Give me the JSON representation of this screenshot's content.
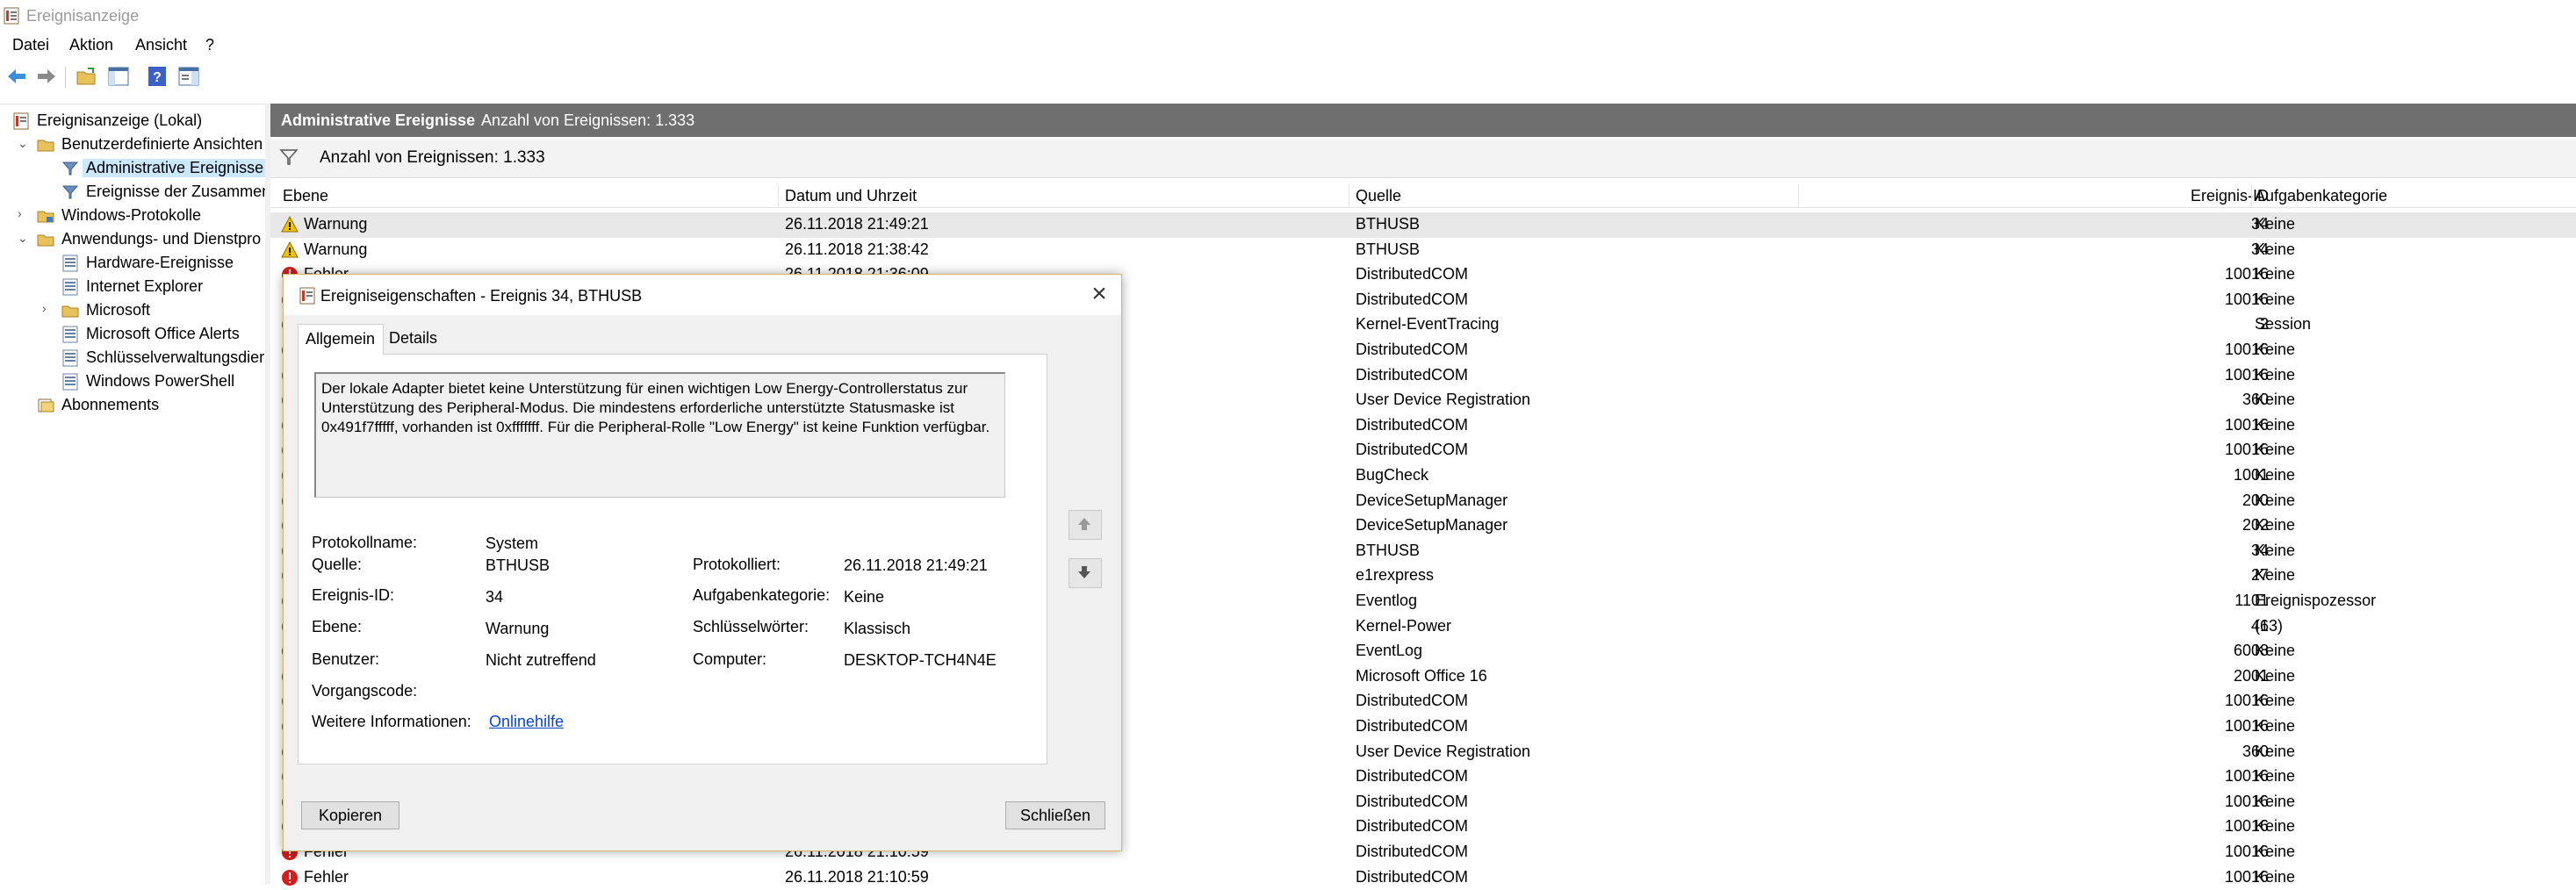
{
  "window": {
    "title": "Ereignisanzeige"
  },
  "menu": [
    "Datei",
    "Aktion",
    "Ansicht",
    "?"
  ],
  "toolbar": {
    "icons": [
      "back-arrow-icon",
      "forward-arrow-icon",
      "open-folder-icon",
      "show-pane-icon",
      "help-icon",
      "properties-pane-icon"
    ]
  },
  "tree": {
    "root": "Ereignisanzeige (Lokal)",
    "custom_views": "Benutzerdefinierte Ansichten",
    "admin_events": "Administrative Ereignisse",
    "summary_events": "Ereignisse der Zusammen",
    "windows_logs": "Windows-Protokolle",
    "apps_services": "Anwendungs- und Dienstpro",
    "hardware": "Hardware-Ereignisse",
    "ie": "Internet Explorer",
    "microsoft": "Microsoft",
    "office_alerts": "Microsoft Office Alerts",
    "key_mgmt": "Schlüsselverwaltungsdier",
    "powershell": "Windows PowerShell",
    "subscriptions": "Abonnements"
  },
  "header": {
    "title": "Administrative Ereignisse",
    "count": "Anzahl von Ereignissen: 1.333"
  },
  "filter": {
    "text": "Anzahl von Ereignissen: 1.333"
  },
  "columns": {
    "level": "Ebene",
    "datetime": "Datum und Uhrzeit",
    "source": "Quelle",
    "eventid": "Ereignis-ID",
    "task": "Aufgabenkategorie"
  },
  "rows": [
    {
      "level": "Warnung",
      "datetime": "26.11.2018 21:49:21",
      "source": "BTHUSB",
      "id": "34",
      "task": "Keine"
    },
    {
      "level": "Warnung",
      "datetime": "26.11.2018 21:38:42",
      "source": "BTHUSB",
      "id": "34",
      "task": "Keine"
    },
    {
      "level": "Fehler",
      "datetime": "26.11.2018 21:36:09",
      "source": "DistributedCOM",
      "id": "10016",
      "task": "Keine"
    },
    {
      "level": "",
      "datetime": "",
      "source": "DistributedCOM",
      "id": "10016",
      "task": "Keine"
    },
    {
      "level": "",
      "datetime": "",
      "source": "Kernel-EventTracing",
      "id": "2",
      "task": "Session"
    },
    {
      "level": "",
      "datetime": "",
      "source": "DistributedCOM",
      "id": "10016",
      "task": "Keine"
    },
    {
      "level": "",
      "datetime": "",
      "source": "DistributedCOM",
      "id": "10016",
      "task": "Keine"
    },
    {
      "level": "",
      "datetime": "",
      "source": "User Device Registration",
      "id": "360",
      "task": "Keine"
    },
    {
      "level": "",
      "datetime": "",
      "source": "DistributedCOM",
      "id": "10016",
      "task": "Keine"
    },
    {
      "level": "",
      "datetime": "",
      "source": "DistributedCOM",
      "id": "10016",
      "task": "Keine"
    },
    {
      "level": "",
      "datetime": "",
      "source": "BugCheck",
      "id": "1001",
      "task": "Keine"
    },
    {
      "level": "",
      "datetime": "",
      "source": "DeviceSetupManager",
      "id": "200",
      "task": "Keine"
    },
    {
      "level": "",
      "datetime": "",
      "source": "DeviceSetupManager",
      "id": "202",
      "task": "Keine"
    },
    {
      "level": "",
      "datetime": "",
      "source": "BTHUSB",
      "id": "34",
      "task": "Keine"
    },
    {
      "level": "",
      "datetime": "",
      "source": "e1rexpress",
      "id": "27",
      "task": "Keine"
    },
    {
      "level": "",
      "datetime": "",
      "source": "Eventlog",
      "id": "1101",
      "task": "Ereignispozessor"
    },
    {
      "level": "",
      "datetime": "",
      "source": "Kernel-Power",
      "id": "41",
      "task": "(63)"
    },
    {
      "level": "",
      "datetime": "",
      "source": "EventLog",
      "id": "6008",
      "task": "Keine"
    },
    {
      "level": "",
      "datetime": "",
      "source": "Microsoft Office 16",
      "id": "2001",
      "task": "Keine"
    },
    {
      "level": "",
      "datetime": "",
      "source": "DistributedCOM",
      "id": "10016",
      "task": "Keine"
    },
    {
      "level": "",
      "datetime": "",
      "source": "DistributedCOM",
      "id": "10016",
      "task": "Keine"
    },
    {
      "level": "",
      "datetime": "",
      "source": "User Device Registration",
      "id": "360",
      "task": "Keine"
    },
    {
      "level": "",
      "datetime": "",
      "source": "DistributedCOM",
      "id": "10016",
      "task": "Keine"
    },
    {
      "level": "",
      "datetime": "",
      "source": "DistributedCOM",
      "id": "10016",
      "task": "Keine"
    },
    {
      "level": "",
      "datetime": "",
      "source": "DistributedCOM",
      "id": "10016",
      "task": "Keine"
    },
    {
      "level": "Fehler",
      "datetime": "26.11.2018 21:10:59",
      "source": "DistributedCOM",
      "id": "10016",
      "task": "Keine"
    },
    {
      "level": "Fehler",
      "datetime": "26.11.2018 21:10:59",
      "source": "DistributedCOM",
      "id": "10016",
      "task": "Keine"
    }
  ],
  "dialog": {
    "title": "Ereigniseigenschaften - Ereignis 34, BTHUSB",
    "tab_general": "Allgemein",
    "tab_details": "Details",
    "description": "Der lokale Adapter bietet keine Unterstützung für einen wichtigen Low Energy-Controllerstatus zur Unterstützung des Peripheral-Modus. Die mindestens erforderliche unterstützte Statusmaske ist 0x491f7fffff, vorhanden ist 0xfffffff. Für die Peripheral-Rolle \"Low Energy\" ist keine Funktion verfügbar.",
    "log_name_label": "Protokollname:",
    "log_name": "System",
    "source_label": "Quelle:",
    "source": "BTHUSB",
    "logged_label": "Protokolliert:",
    "logged": "26.11.2018 21:49:21",
    "event_id_label": "Ereignis-ID:",
    "event_id": "34",
    "task_label": "Aufgabenkategorie:",
    "task": "Keine",
    "level_label": "Ebene:",
    "level": "Warnung",
    "keywords_label": "Schlüsselwörter:",
    "keywords": "Klassisch",
    "user_label": "Benutzer:",
    "user": "Nicht zutreffend",
    "computer_label": "Computer:",
    "computer": "DESKTOP-TCH4N4E",
    "opcode_label": "Vorgangscode:",
    "moreinfo_label": "Weitere Informationen:",
    "moreinfo_link": "Onlinehilfe",
    "copy_button": "Kopieren",
    "close_button": "Schließen"
  },
  "colors": {
    "header_bar": "#6f6f6f",
    "selection": "#cce8ff",
    "link": "#0645d6",
    "warning": "#f2c200",
    "error": "#d11e1e"
  }
}
